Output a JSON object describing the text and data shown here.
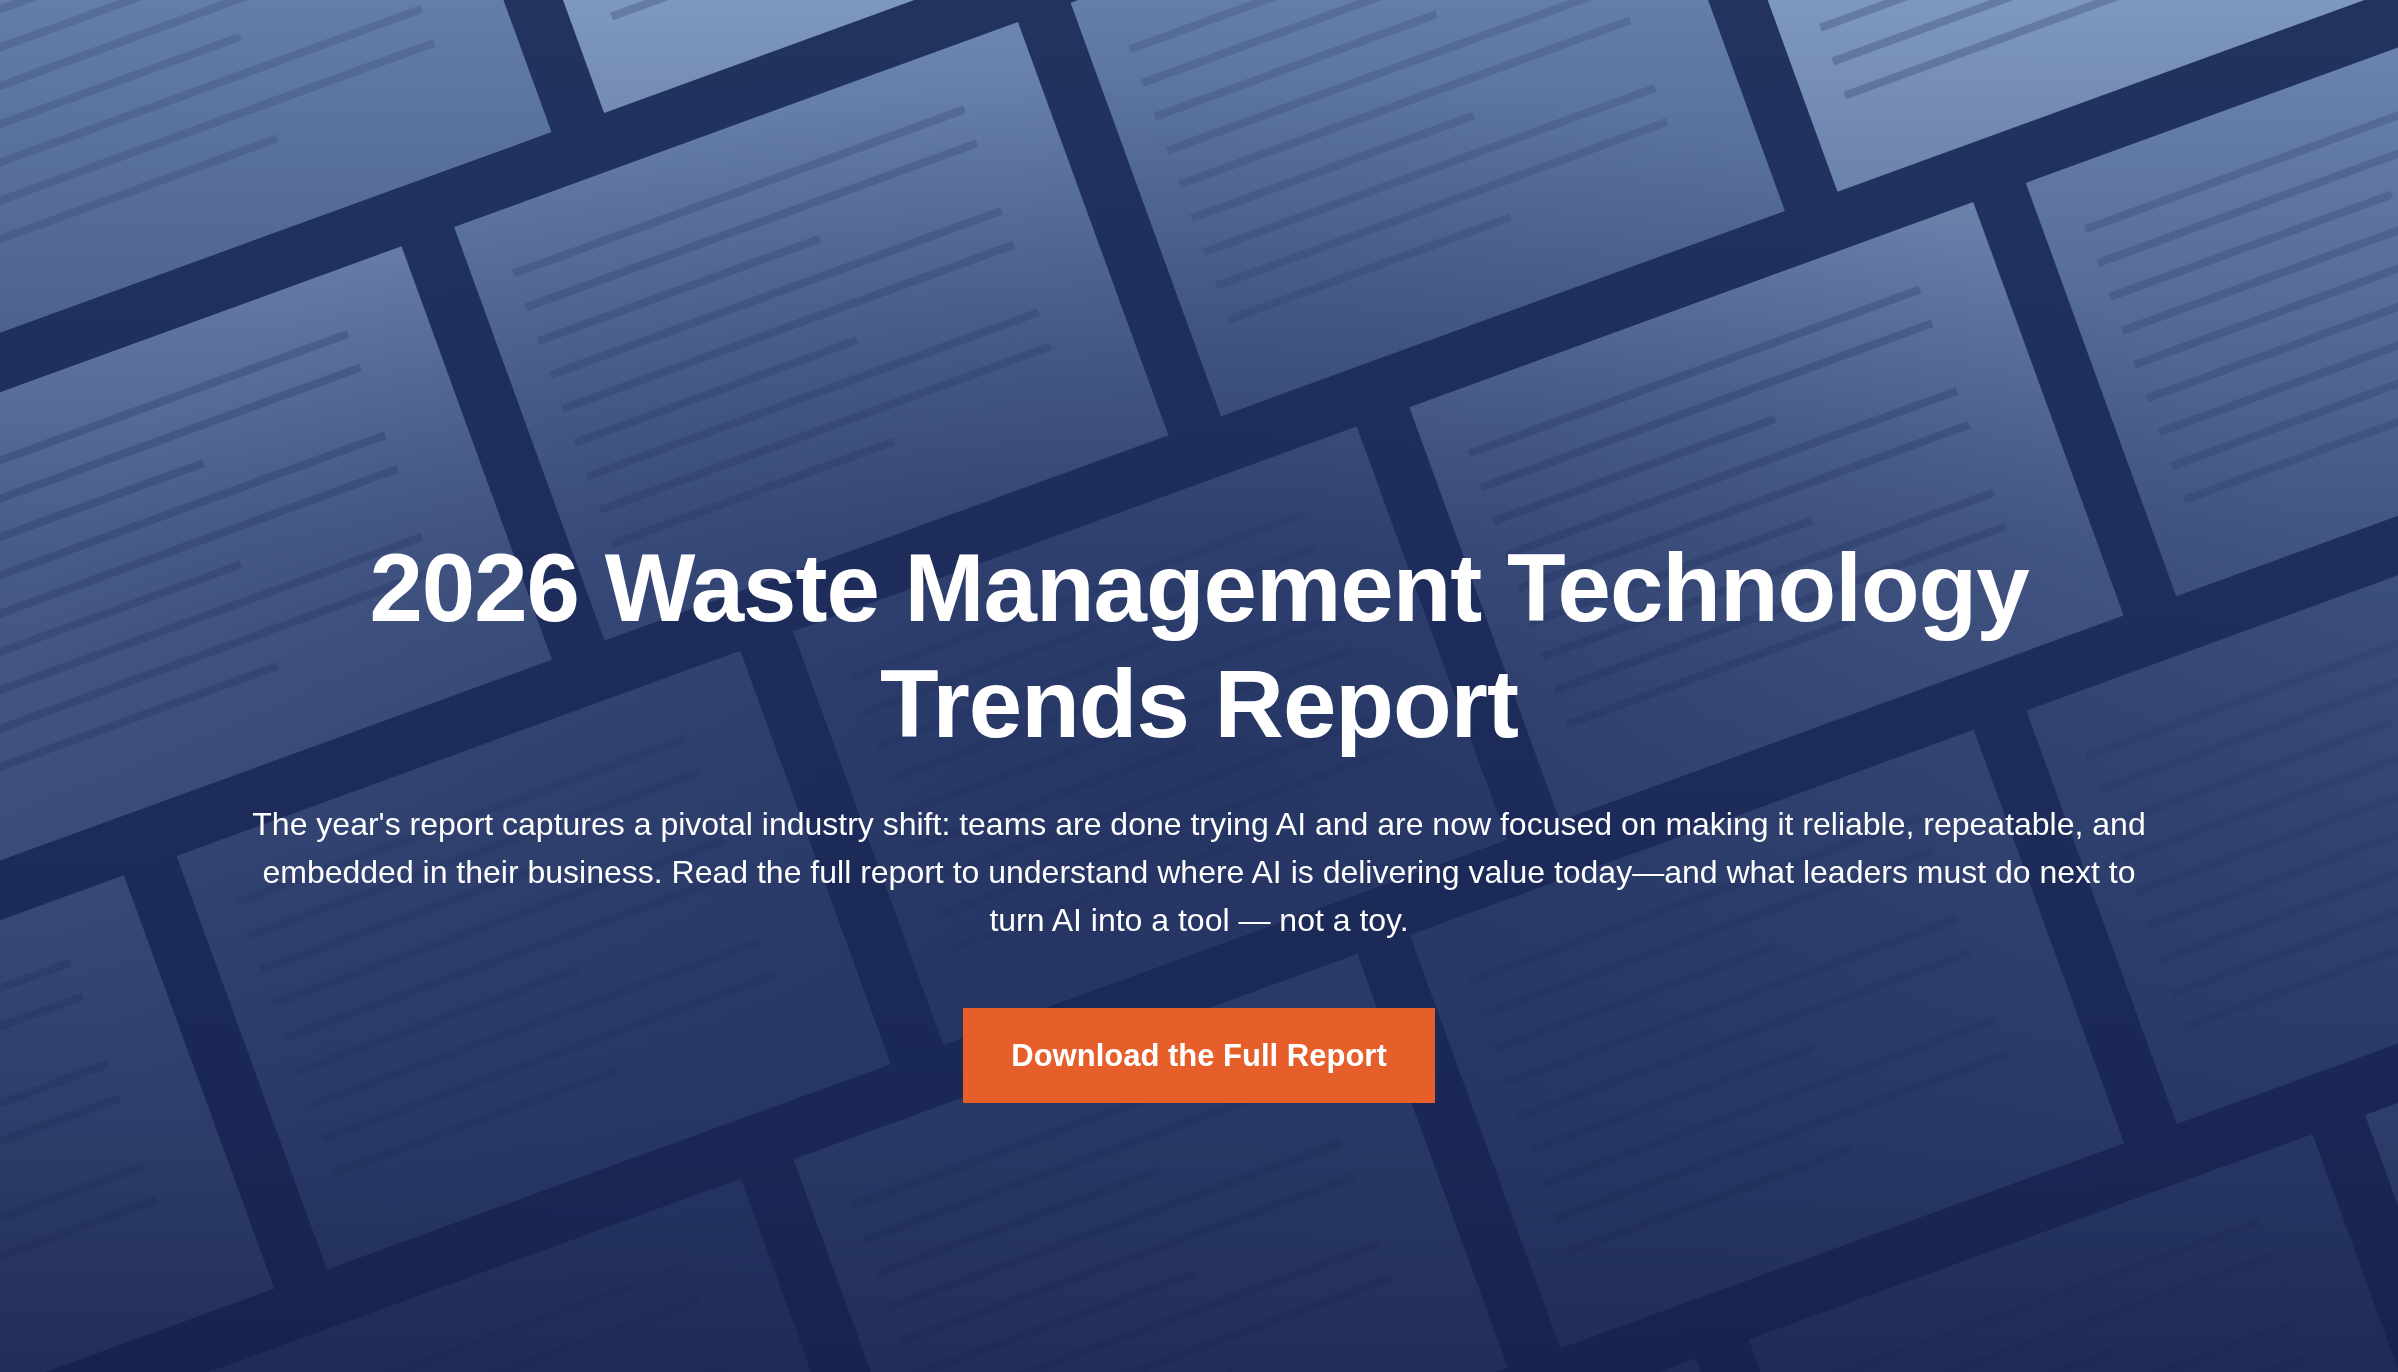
{
  "hero": {
    "title": "2026 Waste Management Technology Trends Report",
    "description": "The year's report captures a pivotal industry shift: teams are done trying AI and are now focused on making it reliable, repeatable, and embedded in their business. Read the full report to understand where AI is delivering value today—and what leaders must do next to turn AI into a tool — not a toy.",
    "button": {
      "label": "Download the Full Report"
    }
  }
}
